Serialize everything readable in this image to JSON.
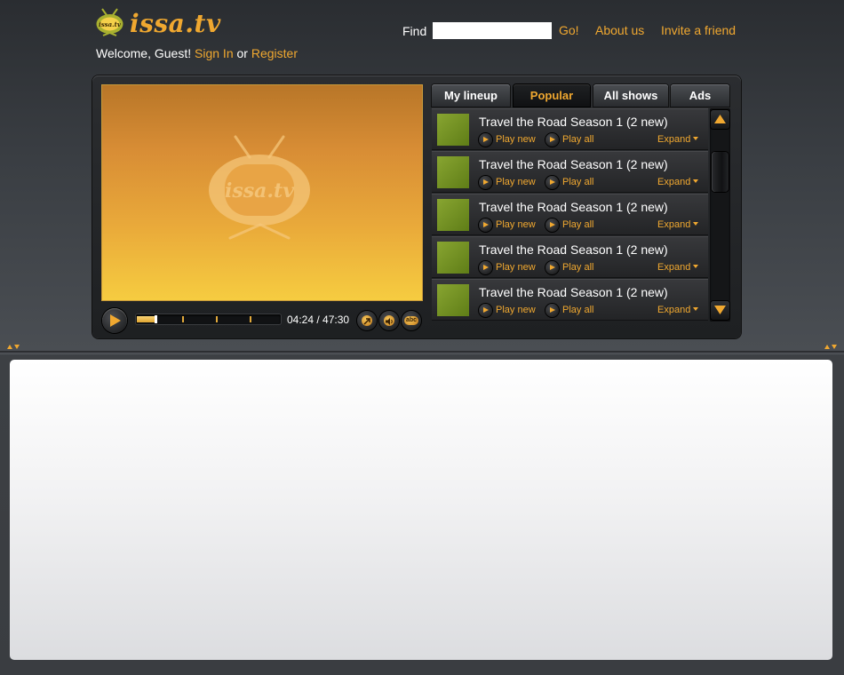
{
  "header": {
    "logo_text": "issa.tv",
    "logo_badge": "issa.tv",
    "welcome_text": "Welcome, Guest!",
    "sign_in": "Sign In",
    "or": "or",
    "register": "Register",
    "find_label": "Find",
    "find_value": "",
    "go": "Go!",
    "about": "About us",
    "invite": "Invite a friend"
  },
  "player": {
    "watermark": "issa.tv",
    "time": "04:24 / 47:30",
    "progress": 0.127,
    "cc_label": "abc"
  },
  "tabs": [
    {
      "label": "My lineup",
      "active": false
    },
    {
      "label": "Popular",
      "active": true
    },
    {
      "label": "All shows",
      "active": false
    },
    {
      "label": "Ads",
      "active": false
    }
  ],
  "shows": [
    {
      "title": "Travel the Road Season 1 (2 new)",
      "play_new": "Play new",
      "play_all": "Play all",
      "expand": "Expand"
    },
    {
      "title": "Travel the Road Season 1 (2 new)",
      "play_new": "Play new",
      "play_all": "Play all",
      "expand": "Expand"
    },
    {
      "title": "Travel the Road Season 1 (2 new)",
      "play_new": "Play new",
      "play_all": "Play all",
      "expand": "Expand"
    },
    {
      "title": "Travel the Road Season 1 (2 new)",
      "play_new": "Play new",
      "play_all": "Play all",
      "expand": "Expand"
    },
    {
      "title": "Travel the Road Season 1 (2 new)",
      "play_new": "Play new",
      "play_all": "Play all",
      "expand": "Expand"
    }
  ],
  "colors": {
    "accent": "#f0a830",
    "thumb": "#7a9a24",
    "video_top": "#b87628",
    "video_bottom": "#f6cc40"
  },
  "icons": [
    "logo-tv-icon",
    "tv-watermark-icon",
    "play-icon",
    "fullscreen-icon",
    "volume-icon",
    "caption-icon",
    "mini-play-icon",
    "chevron-down-icon",
    "scroll-up-icon",
    "scroll-down-icon",
    "resize-arrows-icon"
  ]
}
